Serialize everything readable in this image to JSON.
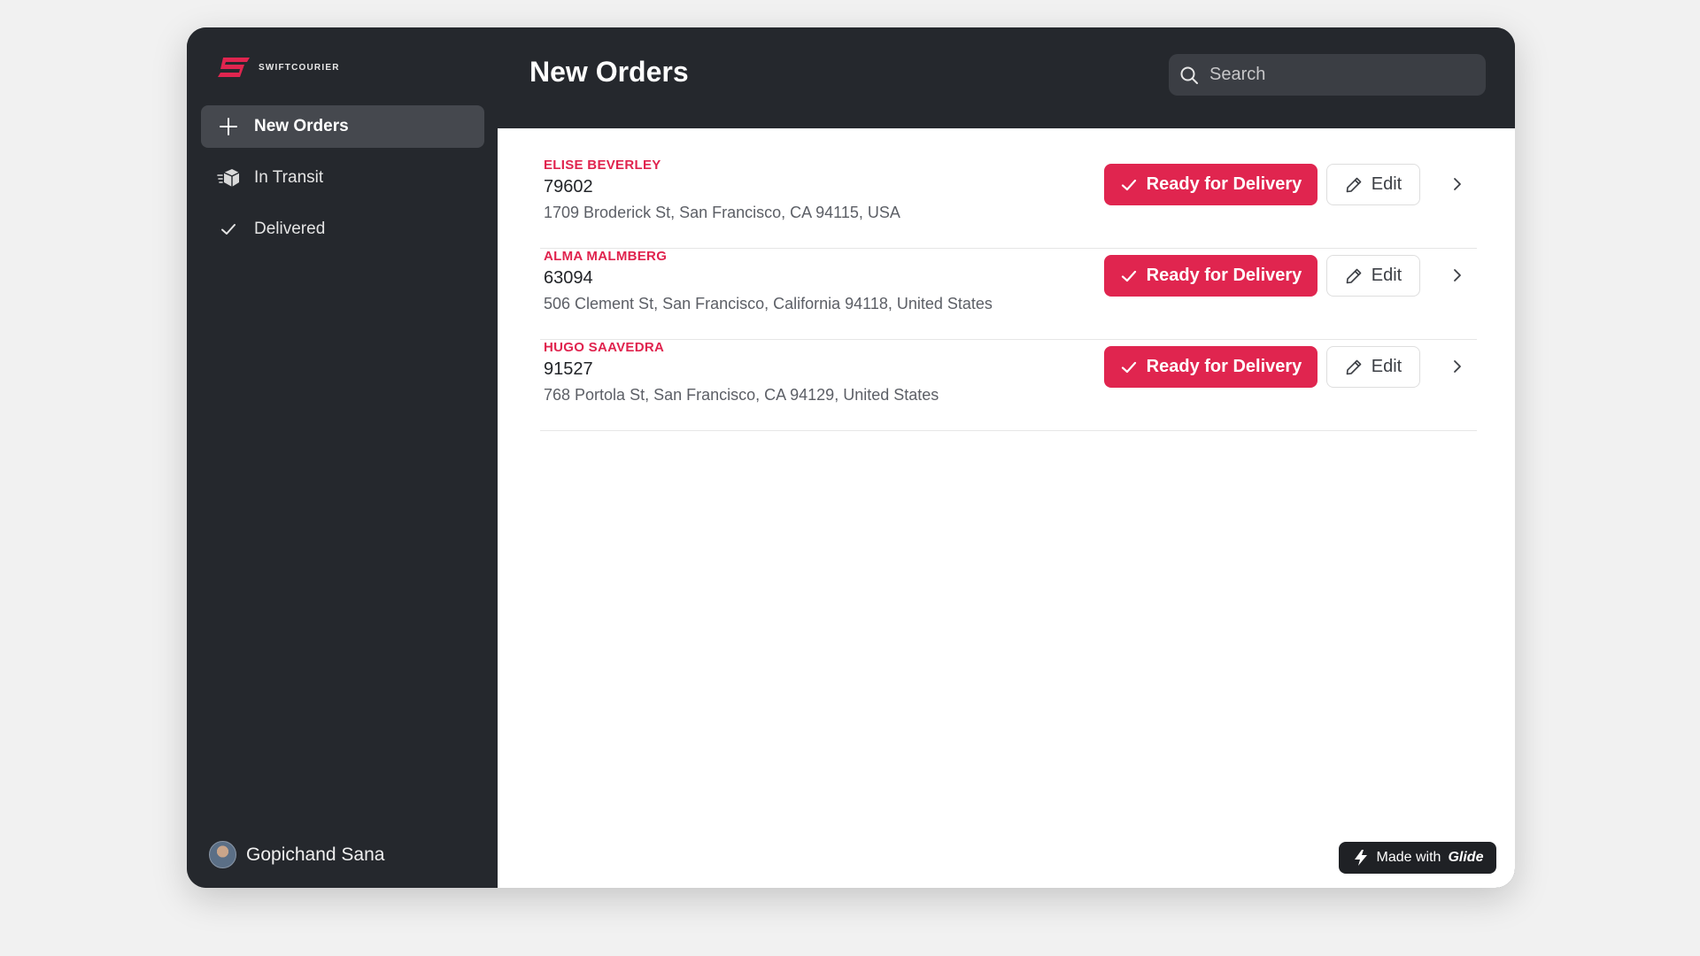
{
  "brand": {
    "name": "SWIFTCOURIER",
    "accent": "#e0254f"
  },
  "sidebar": {
    "items": [
      {
        "label": "New Orders",
        "icon": "plus-icon",
        "active": true
      },
      {
        "label": "In Transit",
        "icon": "package-icon",
        "active": false
      },
      {
        "label": "Delivered",
        "icon": "check-icon",
        "active": false
      }
    ],
    "user": {
      "name": "Gopichand Sana",
      "icon": "avatar"
    }
  },
  "header": {
    "title": "New Orders",
    "search": {
      "placeholder": "Search",
      "value": "",
      "icon": "search-icon"
    }
  },
  "orders": [
    {
      "customer": "ELISE BEVERLEY",
      "order_id": "79602",
      "address": "1709 Broderick St, San Francisco, CA 94115, USA",
      "action": "Ready for Delivery",
      "edit": "Edit"
    },
    {
      "customer": "ALMA MALMBERG",
      "order_id": "63094",
      "address": "506 Clement St, San Francisco, California 94118, United States",
      "action": "Ready for Delivery",
      "edit": "Edit"
    },
    {
      "customer": "HUGO SAAVEDRA",
      "order_id": "91527",
      "address": "768 Portola St, San Francisco, CA 94129, United States",
      "action": "Ready for Delivery",
      "edit": "Edit"
    }
  ],
  "footer": {
    "made_with": "Made with",
    "glide": "Glide"
  }
}
